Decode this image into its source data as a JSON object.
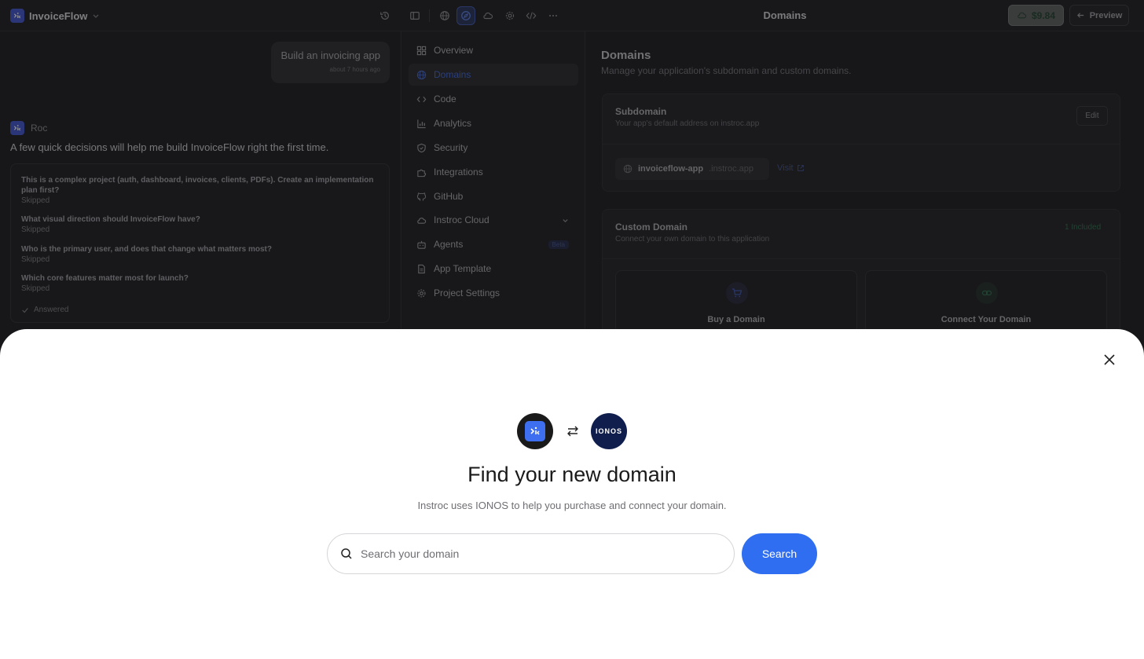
{
  "app": {
    "name": "InvoiceFlow"
  },
  "header": {
    "page_title": "Domains",
    "credit_value": "$9.84",
    "preview_label": "Preview"
  },
  "chat": {
    "user_message": "Build an invoicing app",
    "user_time": "about 7 hours ago",
    "agent_name": "Roc",
    "agent_message": "A few quick decisions will help me build InvoiceFlow right the first time.",
    "questions": [
      {
        "text": "This is a complex project (auth, dashboard, invoices, clients, PDFs). Create an implementation plan first?",
        "status": "Skipped"
      },
      {
        "text": "What visual direction should InvoiceFlow have?",
        "status": "Skipped"
      },
      {
        "text": "Who is the primary user, and does that change what matters most?",
        "status": "Skipped"
      },
      {
        "text": "Which core features matter most for launch?",
        "status": "Skipped"
      }
    ],
    "answered_label": "Answered"
  },
  "nav": {
    "items": [
      {
        "label": "Overview",
        "icon": "grid-icon"
      },
      {
        "label": "Domains",
        "icon": "globe-icon"
      },
      {
        "label": "Code",
        "icon": "code-icon"
      },
      {
        "label": "Analytics",
        "icon": "bar-chart-icon"
      },
      {
        "label": "Security",
        "icon": "shield-icon"
      },
      {
        "label": "Integrations",
        "icon": "puzzle-icon"
      },
      {
        "label": "GitHub",
        "icon": "github-icon"
      },
      {
        "label": "Instroc Cloud",
        "icon": "cloud-icon"
      },
      {
        "label": "Agents",
        "icon": "bot-icon",
        "badge": "Beta"
      },
      {
        "label": "App Template",
        "icon": "file-icon"
      },
      {
        "label": "Project Settings",
        "icon": "gear-icon"
      }
    ],
    "active": "Domains"
  },
  "domains": {
    "title": "Domains",
    "subtitle": "Manage your application's subdomain and custom domains.",
    "subdomain": {
      "title": "Subdomain",
      "subtitle": "Your app's default address on instroc.app",
      "edit_label": "Edit",
      "name": "invoiceflow-app",
      "suffix": ".instroc.app",
      "visit_label": "Visit"
    },
    "custom": {
      "title": "Custom Domain",
      "subtitle": "Connect your own domain to this application",
      "included_label": "1 Included",
      "buy_label": "Buy a Domain",
      "connect_label": "Connect Your Domain"
    }
  },
  "modal": {
    "ionos_logo_text": "IONOS",
    "title": "Find your new domain",
    "subtitle": "Instroc uses IONOS to help you purchase and connect your domain.",
    "search_placeholder": "Search your domain",
    "search_value": "",
    "search_button": "Search"
  },
  "colors": {
    "accent": "#2f6ef0",
    "ionos": "#0f1e4d",
    "included": "#2e6a4a"
  }
}
